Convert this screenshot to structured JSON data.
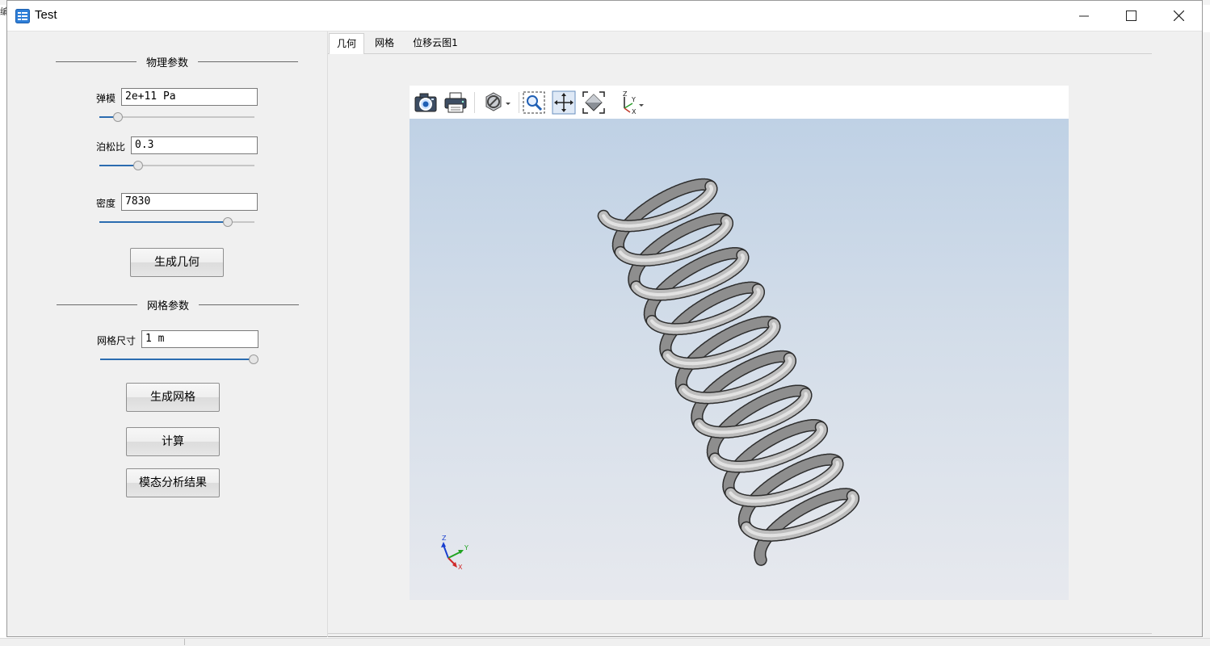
{
  "background": {
    "left_glyph": "编"
  },
  "window": {
    "title": "Test",
    "app_icon": "table-app-icon",
    "controls": [
      "minimize-icon",
      "maximize-icon",
      "close-icon"
    ]
  },
  "physics_group": {
    "title": "物理参数",
    "youngs_modulus": {
      "label": "弹模",
      "value": "2e+11 Pa",
      "slider_fraction": 0.11
    },
    "poisson_ratio": {
      "label": "泊松比",
      "value": "0.3",
      "slider_fraction": 0.25
    },
    "density": {
      "label": "密度",
      "value": "7830",
      "slider_fraction": 0.82
    },
    "generate_geometry_label": "生成几何"
  },
  "mesh_group": {
    "title": "网格参数",
    "mesh_size": {
      "label": "网格尺寸",
      "value": "1 m",
      "slider_fraction": 1.0
    },
    "generate_mesh_label": "生成网格",
    "compute_label": "计算",
    "modal_result_label": "模态分析结果"
  },
  "tabs": [
    {
      "label": "几何",
      "active": true
    },
    {
      "label": "网格",
      "active": false
    },
    {
      "label": "位移云图1",
      "active": false
    }
  ],
  "viewer": {
    "toolbar_icons": [
      "camera-icon",
      "print-icon",
      "display-mode-icon",
      "zoom-window-icon",
      "pan-icon",
      "fit-all-icon",
      "view-axes-icon"
    ],
    "model": "helical-spring",
    "triad": {
      "x": "X",
      "y": "Y",
      "z": "Z"
    },
    "colors": {
      "bg_top": "#bfd1e5",
      "bg_bottom": "#e7e9ee",
      "model": "#b4b4b4",
      "accent": "#2b6cb0"
    }
  }
}
